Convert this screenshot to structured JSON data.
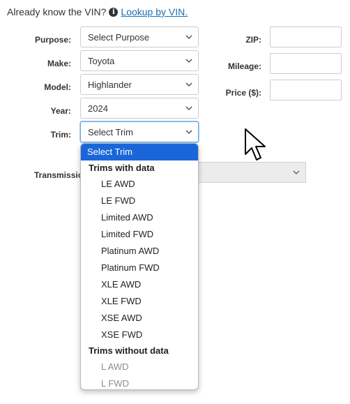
{
  "vin": {
    "prompt": "Already know the VIN?",
    "info_glyph": "i",
    "link": "Lookup by VIN."
  },
  "form": {
    "purpose": {
      "label": "Purpose:",
      "value": "Select Purpose"
    },
    "make": {
      "label": "Make:",
      "value": "Toyota"
    },
    "model": {
      "label": "Model:",
      "value": "Highlander"
    },
    "year": {
      "label": "Year:",
      "value": "2024"
    },
    "trim": {
      "label": "Trim:",
      "value": "Select Trim"
    },
    "transmission": {
      "label": "Transmissio"
    },
    "zip": {
      "label": "ZIP:",
      "value": ""
    },
    "mileage": {
      "label": "Mileage:",
      "value": ""
    },
    "price": {
      "label": "Price ($):",
      "value": ""
    }
  },
  "trim_dropdown": {
    "selected": "Select Trim",
    "group_with_data": "Trims with data",
    "with_data": [
      "LE AWD",
      "LE FWD",
      "Limited AWD",
      "Limited FWD",
      "Platinum AWD",
      "Platinum FWD",
      "XLE AWD",
      "XLE FWD",
      "XSE AWD",
      "XSE FWD"
    ],
    "group_without_data": "Trims without data",
    "without_data": [
      "L AWD",
      "L FWD"
    ]
  },
  "icons": {
    "info": "info-circle-icon",
    "chevron": "chevron-down-icon",
    "cursor": "mouse-pointer-icon"
  },
  "colors": {
    "link": "#1a6fb3",
    "highlight": "#1a66d9"
  }
}
